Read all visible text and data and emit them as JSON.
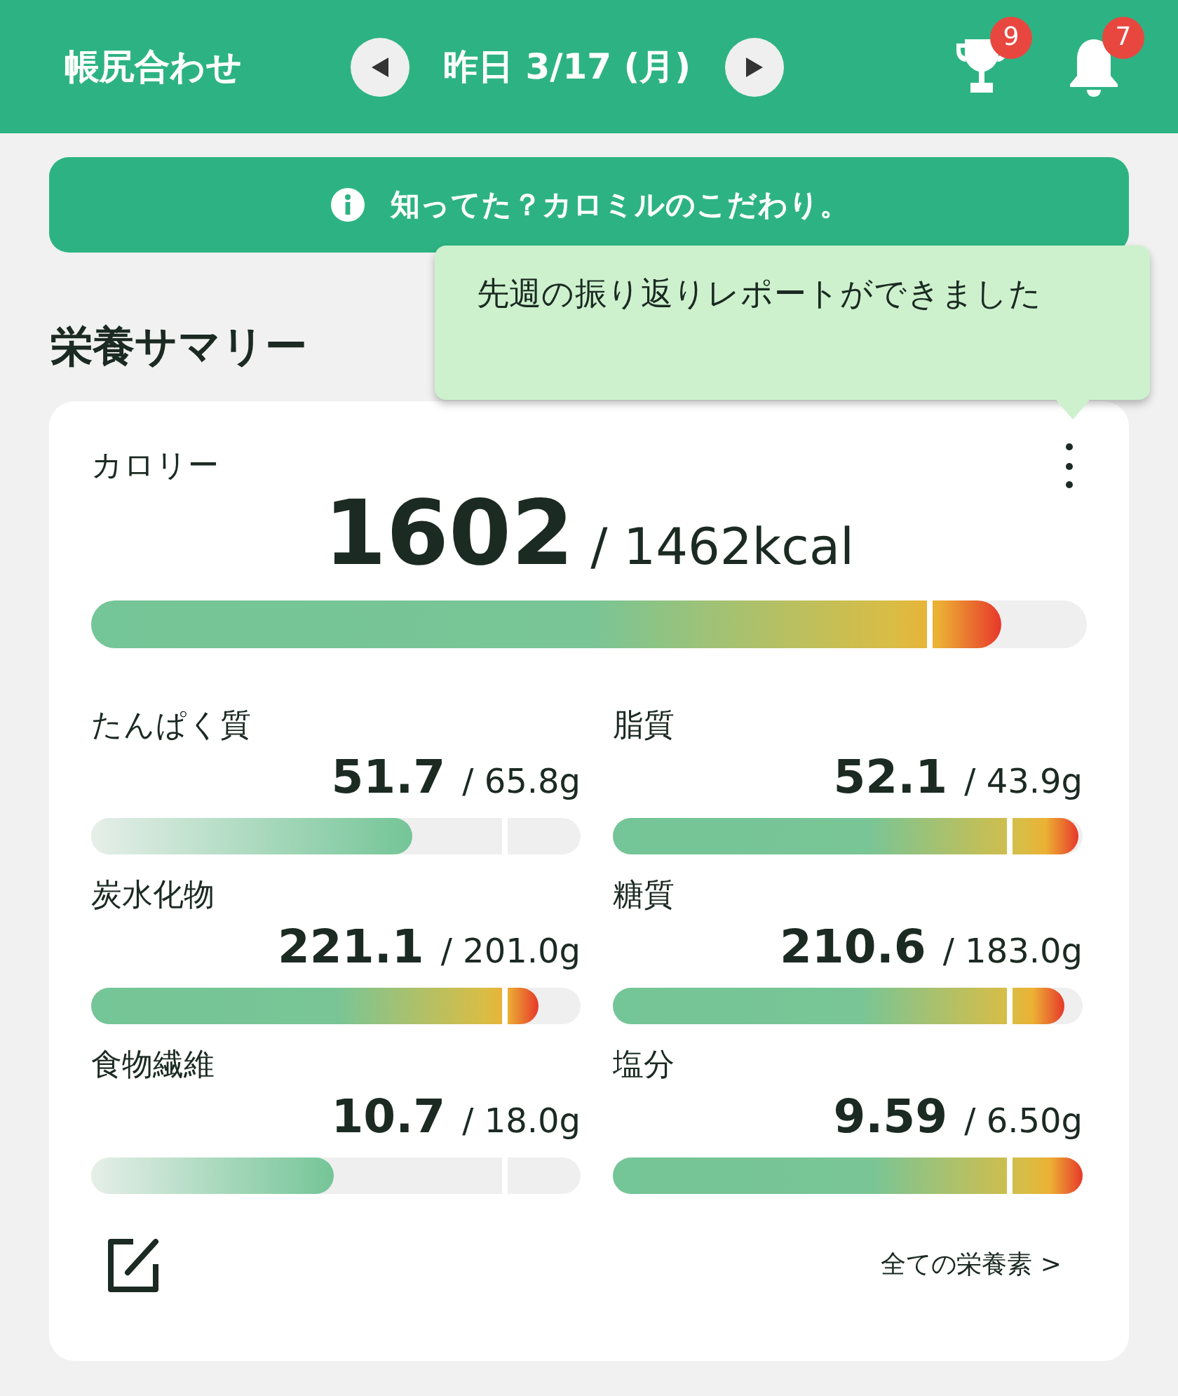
{
  "header": {
    "title": "帳尻合わせ",
    "date": "昨日 3/17 (月)",
    "trophy_badge": "9",
    "bell_badge": "7"
  },
  "banner": {
    "text": "知ってた？カロミルのこだわり。"
  },
  "tooltip": {
    "text": "先週の振り返りレポートができました"
  },
  "section_title": "栄養サマリー",
  "calorie": {
    "label": "カロリー",
    "value": "1602",
    "target": "/ 1462kcal",
    "level": 0.914
  },
  "nutrients": [
    {
      "label": "たんぱく質",
      "value": "51.7",
      "target": "/ 65.8g",
      "level": 0.656
    },
    {
      "label": "脂質",
      "value": "52.1",
      "target": "/ 43.9g",
      "level": 0.99
    },
    {
      "label": "炭水化物",
      "value": "221.1",
      "target": "/ 201.0g",
      "level": 0.914
    },
    {
      "label": "糖質",
      "value": "210.6",
      "target": "/ 183.0g",
      "level": 0.96
    },
    {
      "label": "食物繊維",
      "value": "10.7",
      "target": "/ 18.0g",
      "level": 0.496
    },
    {
      "label": "塩分",
      "value": "9.59",
      "target": "/ 6.50g",
      "level": 1.0
    }
  ],
  "all_nutrients_link": "全ての栄養素 >"
}
